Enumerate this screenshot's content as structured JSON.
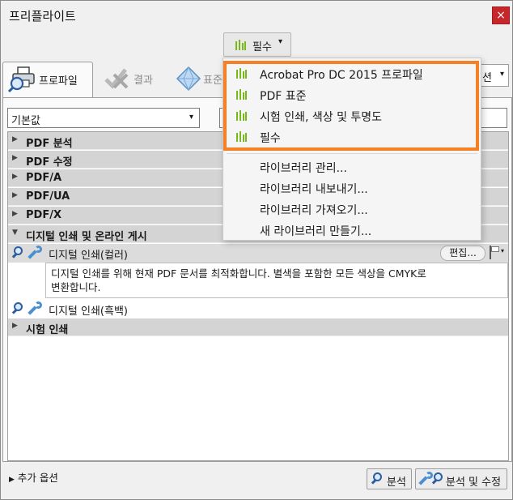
{
  "window": {
    "title": "프리플라이트",
    "close_label": "×"
  },
  "toolbar": {
    "preset_label": "필수",
    "caret": "▾"
  },
  "tabs": [
    {
      "label": "프로파일",
      "icon": "printer-magnify-icon",
      "active": true
    },
    {
      "label": "결과",
      "icon": "checkmark-x-icon",
      "active": false
    },
    {
      "label": "표준",
      "icon": "diamond-icon",
      "active": false
    }
  ],
  "options_dropdown": {
    "label": "션",
    "caret": "▾"
  },
  "filter": {
    "value": "기본값",
    "caret": "▾"
  },
  "categories": [
    {
      "label": "PDF 분석",
      "arrow": "▶"
    },
    {
      "label": "PDF 수정",
      "arrow": "▶"
    },
    {
      "label": "PDF/A",
      "arrow": "▶"
    },
    {
      "label": "PDF/UA",
      "arrow": "▶"
    },
    {
      "label": "PDF/X",
      "arrow": "▶"
    },
    {
      "label": "디지털 인쇄 및 온라인 게시",
      "arrow": "▼"
    },
    {
      "label": "시험 인쇄",
      "arrow": "▶"
    }
  ],
  "profiles": [
    {
      "label": "디지털 인쇄(컬러)",
      "edit_label": "편집...",
      "description_line1": "디지털 인쇄를 위해 현재 PDF 문서를 최적화합니다. 별색을 포함한 모든 색상을 CMYK로",
      "description_line2": "변환합니다."
    },
    {
      "label": "디지털 인쇄(흑백)"
    }
  ],
  "footer": {
    "more_options_label": "추가 옵션",
    "more_options_arrow": "▶",
    "analyze_label": "분석",
    "analyze_fix_label": "분석 및 수정"
  },
  "menu": {
    "library_items": [
      "Acrobat Pro DC 2015 프로파일",
      "PDF 표준",
      "시험 인쇄, 색상 및 투명도",
      "필수"
    ],
    "action_items": [
      "라이브러리 관리...",
      "라이브러리 내보내기...",
      "라이브러리 가져오기...",
      "새 라이브러리 만들기..."
    ],
    "highlight_color": "#f58025",
    "icon_color": "#79b81b"
  }
}
